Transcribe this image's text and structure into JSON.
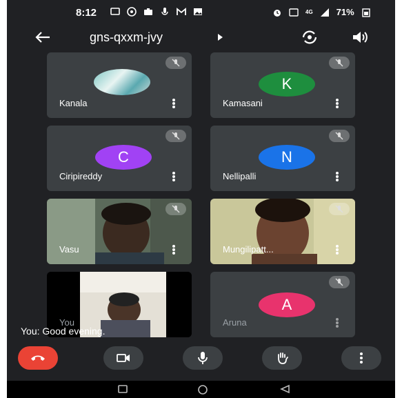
{
  "status_bar": {
    "time": "8:12",
    "signal": "4G",
    "battery": "71%"
  },
  "meeting": {
    "code": "gns-qxxm-jvy"
  },
  "participants": [
    {
      "name": "Kanala",
      "avatar": "photo",
      "muted": true
    },
    {
      "name": "Kamasani",
      "initial": "K",
      "color": "#1e8e3e",
      "muted": true
    },
    {
      "name": "Ciripireddy",
      "initial": "C",
      "color": "#a142f4",
      "muted": true
    },
    {
      "name": "Nellipalli",
      "initial": "N",
      "color": "#1a73e8",
      "muted": true
    },
    {
      "name": "Vasu",
      "avatar": "video",
      "muted": true
    },
    {
      "name": "Mungilipatt...",
      "avatar": "video",
      "muted": true
    },
    {
      "name": "You",
      "avatar": "video",
      "muted": false
    },
    {
      "name": "Aruna",
      "initial": "A",
      "color": "#e8336d",
      "muted": true
    }
  ],
  "caption": {
    "speaker": "You",
    "text": "You: Good evening."
  },
  "controls": [
    "end-call",
    "camera",
    "microphone",
    "raise-hand",
    "more-options"
  ],
  "colors": {
    "background": "#202124",
    "tile": "#3c4043",
    "end_call": "#ea4335"
  }
}
